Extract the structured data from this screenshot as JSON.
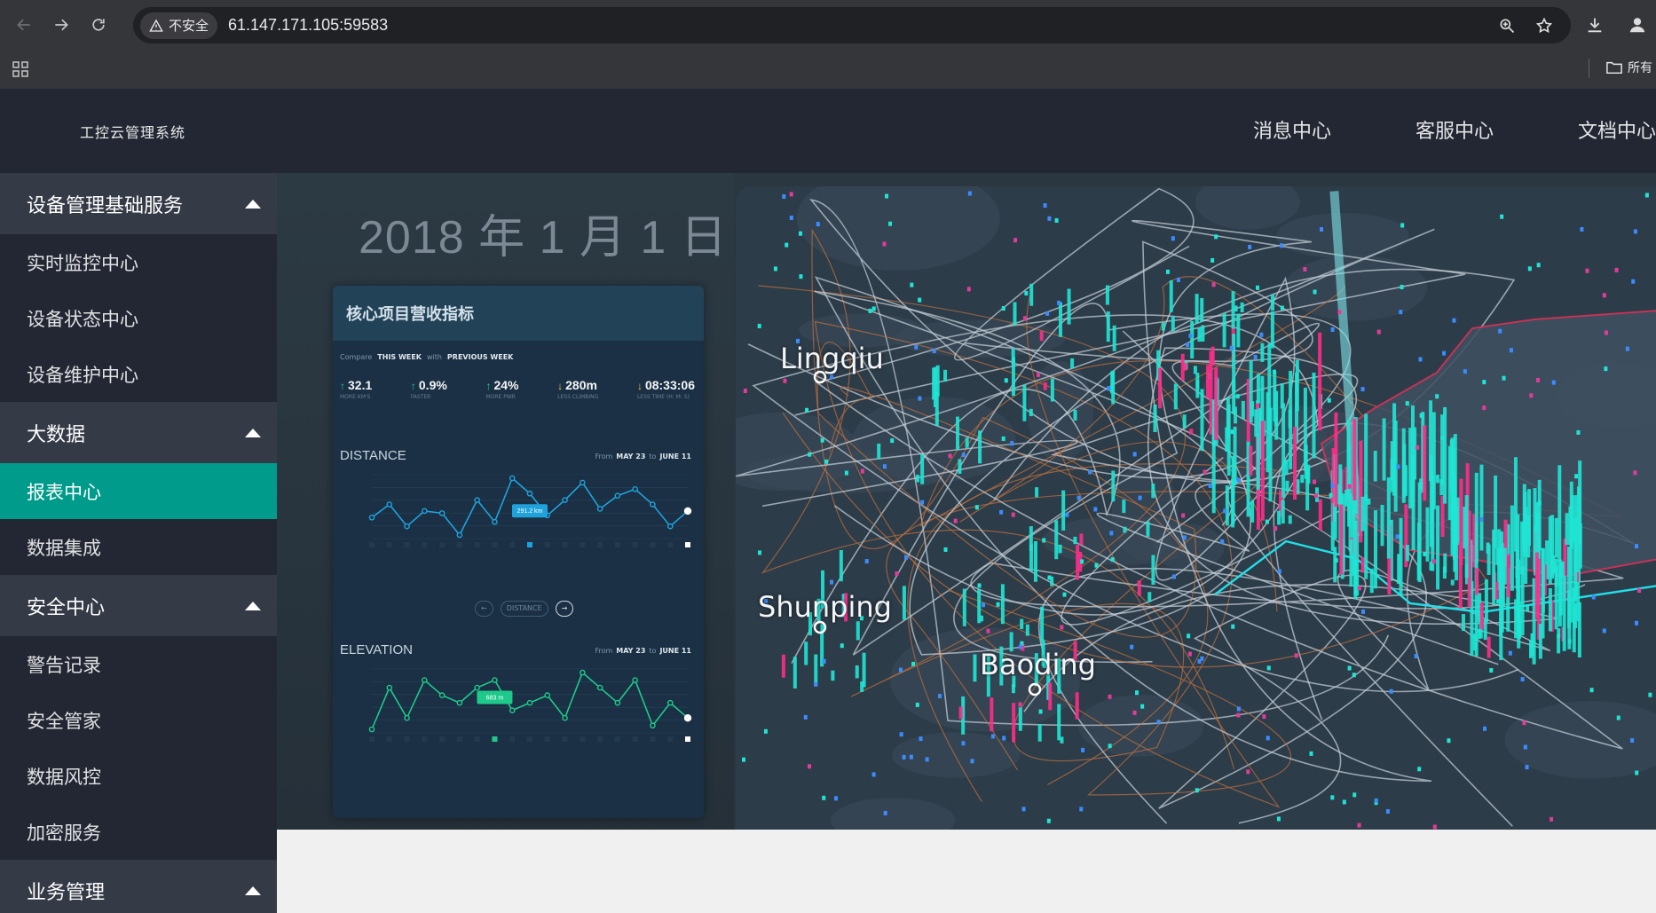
{
  "browser": {
    "security_chip": "不安全",
    "url": "61.147.171.105:59583",
    "bookmark_folder": "所有"
  },
  "header": {
    "app_title": "工控云管理系统",
    "nav": [
      "消息中心",
      "客服中心",
      "文档中心"
    ]
  },
  "sidebar": {
    "groups": [
      {
        "label": "设备管理基础服务",
        "items": [
          "实时监控中心",
          "设备状态中心",
          "设备维护中心"
        ]
      },
      {
        "label": "大数据",
        "items": [
          "报表中心",
          "数据集成"
        ],
        "active_item": "报表中心"
      },
      {
        "label": "安全中心",
        "items": [
          "警告记录",
          "安全管家",
          "数据风控",
          "加密服务"
        ]
      },
      {
        "label": "业务管理",
        "items": []
      }
    ]
  },
  "banner": {
    "date": "2018 年 1 月 1 日",
    "panel_title": "核心项目营收指标",
    "compare": {
      "label": "Compare",
      "this": "THIS WEEK",
      "with": "with",
      "prev": "PREVIOUS WEEK"
    },
    "stats": [
      {
        "value": "32.1",
        "label": "MORE KM'S",
        "dir": "up"
      },
      {
        "value": "0.9%",
        "label": "FASTER",
        "dir": "up"
      },
      {
        "value": "24%",
        "label": "MORE PWR",
        "dir": "up"
      },
      {
        "value": "280m",
        "label": "LESS CLIMBING",
        "dir": "down"
      },
      {
        "value": "08:33:06",
        "label": "LESS TIME (H: M: S)",
        "dir": "down"
      }
    ],
    "distance": {
      "title": "DISTANCE",
      "from": "From",
      "from_date": "MAY 23",
      "to": "to",
      "to_date": "JUNE 11",
      "tooltip": "291.2 km",
      "color": "#1fa2dc"
    },
    "elevation": {
      "title": "ELEVATION",
      "from": "From",
      "from_date": "MAY 23",
      "to": "to",
      "to_date": "JUNE 11",
      "tooltip": "683 m",
      "color": "#1fc98c"
    },
    "pager": {
      "label": "DISTANCE"
    },
    "cities": [
      "Lingqiu",
      "Shunping",
      "Baoding"
    ]
  },
  "colors": {
    "accent": "#009b8a",
    "sidebar_bg": "#232733",
    "group_bg": "#353a47"
  },
  "chart_data": [
    {
      "type": "line",
      "title": "DISTANCE",
      "values": [
        160,
        190,
        140,
        175,
        170,
        120,
        200,
        150,
        250,
        215,
        165,
        200,
        240,
        180,
        210,
        225,
        190,
        140,
        175
      ],
      "highlight_index": 9,
      "highlight_label": "291.2 km"
    },
    {
      "type": "line",
      "title": "ELEVATION",
      "values": [
        450,
        1000,
        600,
        1100,
        900,
        800,
        1000,
        1100,
        700,
        800,
        900,
        600,
        1200,
        1000,
        800,
        1100,
        500,
        800,
        600
      ],
      "highlight_index": 7,
      "highlight_label": "683 m"
    }
  ]
}
